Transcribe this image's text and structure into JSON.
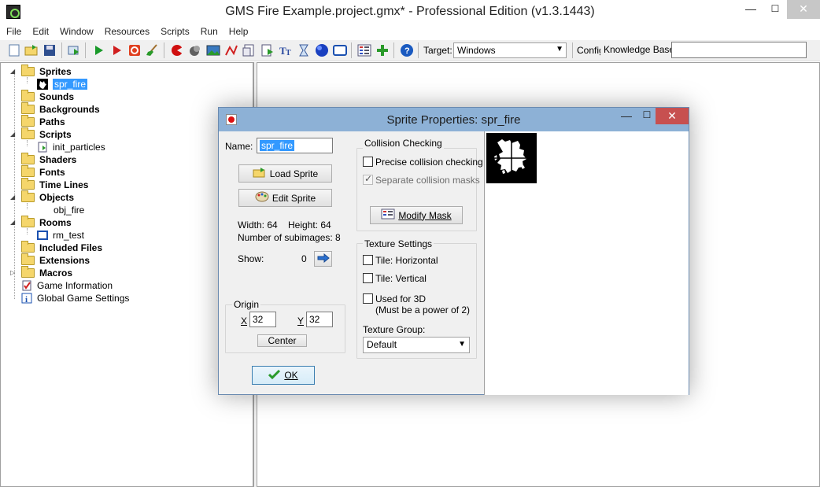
{
  "window": {
    "title": "GMS Fire Example.project.gmx*  -  Professional Edition (v1.3.1443)",
    "min_glyph": "—",
    "max_glyph": "☐",
    "close_glyph": "✕"
  },
  "menu": {
    "items": [
      "File",
      "Edit",
      "Window",
      "Resources",
      "Scripts",
      "Run",
      "Help"
    ]
  },
  "toolbar": {
    "target_label": "Target:",
    "target_value": "Windows",
    "config_label": "Config",
    "kb_label": "Knowledge Base:",
    "kb_value": ""
  },
  "tree": {
    "sprites": "Sprites",
    "spr_fire": "spr_fire",
    "sounds": "Sounds",
    "backgrounds": "Backgrounds",
    "paths": "Paths",
    "scripts": "Scripts",
    "init_particles": "init_particles",
    "shaders": "Shaders",
    "fonts": "Fonts",
    "time_lines": "Time Lines",
    "objects": "Objects",
    "obj_fire": "obj_fire",
    "rooms": "Rooms",
    "rm_test": "rm_test",
    "included_files": "Included Files",
    "extensions": "Extensions",
    "macros": "Macros",
    "game_information": "Game Information",
    "global_game_settings": "Global Game Settings"
  },
  "dialog": {
    "title": "Sprite Properties: spr_fire",
    "name_label": "Name:",
    "name_value": "spr_fire",
    "load_sprite": "Load Sprite",
    "edit_sprite": "Edit Sprite",
    "width_text": "Width: 64",
    "height_text": "Height: 64",
    "subimages_text": "Number of subimages: 8",
    "show_label": "Show:",
    "show_value": "0",
    "origin": {
      "title": "Origin",
      "x_label": "X",
      "x_value": "32",
      "y_label": "Y",
      "y_value": "32",
      "center": "Center"
    },
    "ok": "OK",
    "collision": {
      "title": "Collision Checking",
      "precise": "Precise collision checking",
      "separate": "Separate collision masks",
      "modify_mask": "Modify Mask"
    },
    "texture": {
      "title": "Texture Settings",
      "tile_h": "Tile: Horizontal",
      "tile_v": "Tile: Vertical",
      "used_3d": "Used for 3D",
      "power_of_2": "(Must be a power of 2)",
      "group_label": "Texture Group:",
      "group_value": "Default"
    }
  },
  "colors": {
    "dialog_titlebar": "#8db1d6",
    "close_button": "#c75050",
    "selection": "#3399ff"
  }
}
